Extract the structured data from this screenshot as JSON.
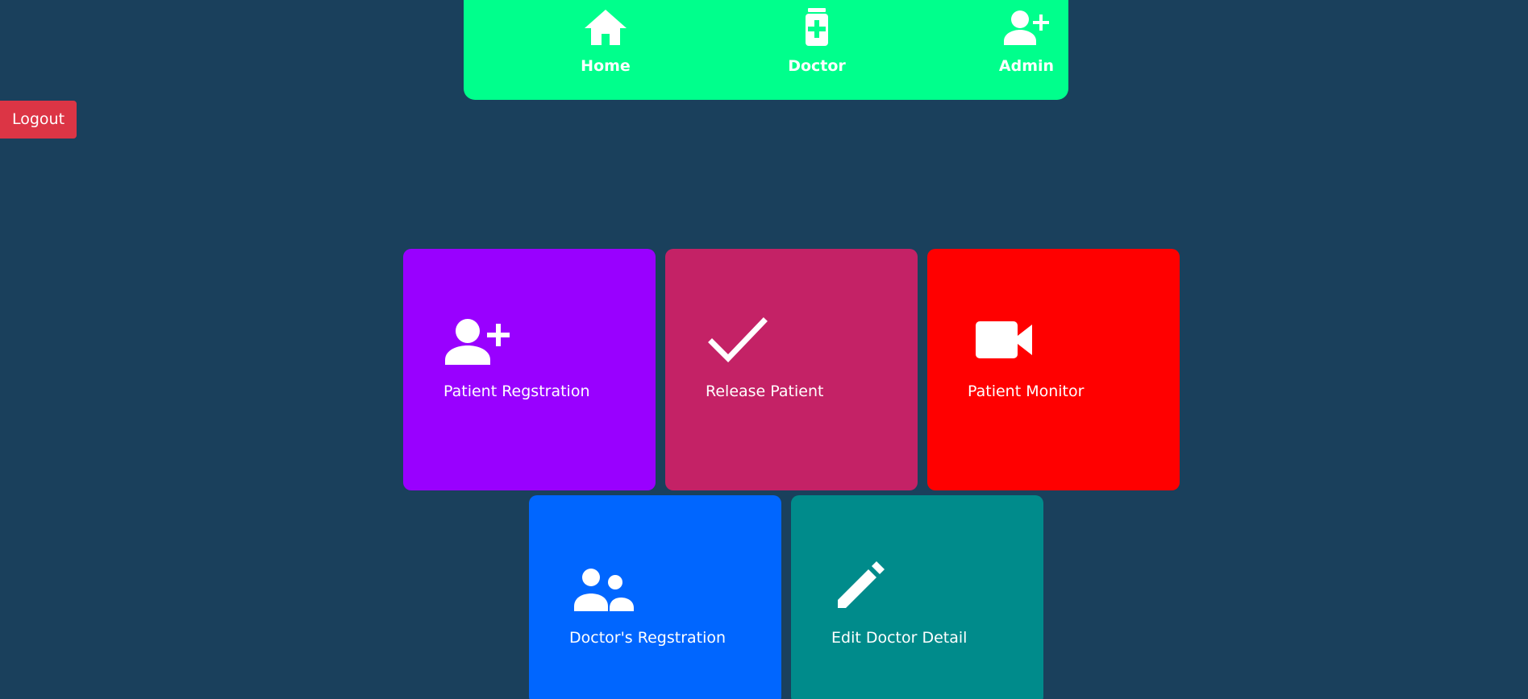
{
  "nav": {
    "items": [
      {
        "label": "Home",
        "icon": "home-icon"
      },
      {
        "label": "Doctor",
        "icon": "medicine-bottle-icon"
      },
      {
        "label": "Admin",
        "icon": "add-user-icon"
      }
    ],
    "color": "#00ff8c"
  },
  "logout": {
    "label": "Logout",
    "color": "#dc3545"
  },
  "tiles": [
    {
      "label": "Patient Regstration",
      "icon": "add-user-icon",
      "color": "#9900ff"
    },
    {
      "label": "Release Patient",
      "icon": "checkmark-icon",
      "color": "#c42266"
    },
    {
      "label": "Patient Monitor",
      "icon": "video-camera-icon",
      "color": "#ff0000"
    },
    {
      "label": "Doctor's Regstration",
      "icon": "people-icon",
      "color": "#0066ff"
    },
    {
      "label": "Edit Doctor Detail",
      "icon": "pencil-icon",
      "color": "#008b8b"
    }
  ],
  "background": "#1a405c"
}
